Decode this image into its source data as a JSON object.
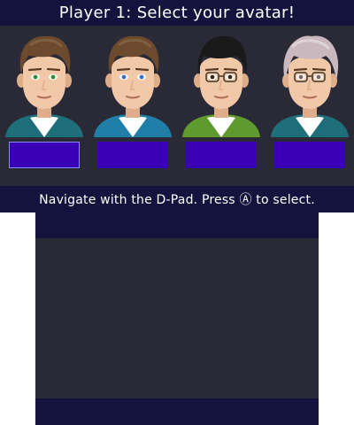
{
  "top_screen": {
    "title": "Player 1: Select your avatar!",
    "hint": "Navigate with the D-Pad. Press Ⓐ to select."
  },
  "avatars": [
    {
      "icon": "avatar-brown-hair-green-eyes",
      "hair": "#6b4a2e",
      "eyes": "#2e8b3a",
      "jacket": "#1f6f7a",
      "glasses": false
    },
    {
      "icon": "avatar-brown-hair-blue-eyes",
      "hair": "#6b4a2e",
      "eyes": "#3a6fc9",
      "jacket": "#1f7fa8",
      "glasses": false
    },
    {
      "icon": "avatar-black-hair-glasses",
      "hair": "#1a1a1a",
      "eyes": "#3a2a1e",
      "jacket": "#5f9a2e",
      "glasses": true
    },
    {
      "icon": "avatar-grey-hair-glasses",
      "hair": "#c9b9bf",
      "eyes": "#7a6a6a",
      "jacket": "#1f6f7a",
      "glasses": true
    }
  ],
  "selected_slot": 0,
  "colors": {
    "bar": "#13133d",
    "background": "#2a2a37",
    "slot": "#3a00b5",
    "slot_selected_border": "#8a8aff"
  }
}
